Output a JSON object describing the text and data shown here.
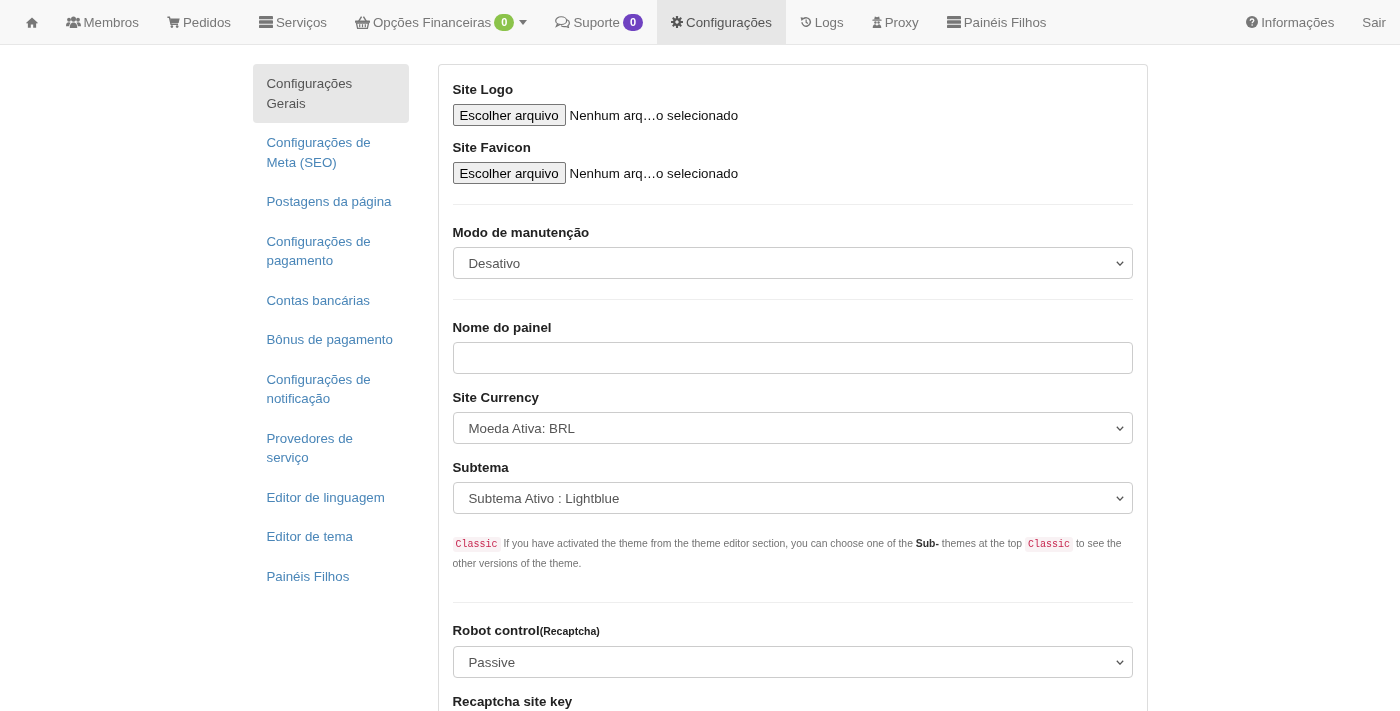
{
  "nav": {
    "home": {
      "selected": false
    },
    "items": [
      {
        "label": "Membros",
        "selected": false
      },
      {
        "label": "Pedidos",
        "selected": false
      },
      {
        "label": "Serviços",
        "selected": false
      },
      {
        "label": "Opções Financeiras",
        "selected": false,
        "badge": {
          "text": "0",
          "color": "#8bc34a"
        },
        "dropdown": true
      },
      {
        "label": "Suporte",
        "selected": false,
        "badge": {
          "text": "0",
          "color": "#6f42c1"
        }
      },
      {
        "label": "Configurações",
        "selected": true
      },
      {
        "label": "Logs",
        "selected": false
      },
      {
        "label": "Proxy",
        "selected": false
      },
      {
        "label": "Painéis Filhos",
        "selected": false
      }
    ],
    "right_items": [
      {
        "label": "Informações",
        "selected": false
      },
      {
        "label": "Sair",
        "selected": false
      }
    ]
  },
  "sidebar": {
    "items": [
      {
        "label": "Configurações Gerais",
        "selected": true
      },
      {
        "label": "Configurações de Meta (SEO)",
        "selected": false
      },
      {
        "label": "Postagens da página",
        "selected": false
      },
      {
        "label": "Configurações de pagamento",
        "selected": false
      },
      {
        "label": "Contas bancárias",
        "selected": false
      },
      {
        "label": "Bônus de pagamento",
        "selected": false
      },
      {
        "label": "Configurações de notificação",
        "selected": false
      },
      {
        "label": "Provedores de serviço",
        "selected": false
      },
      {
        "label": "Editor de linguagem",
        "selected": false
      },
      {
        "label": "Editor de tema",
        "selected": false
      },
      {
        "label": "Painéis Filhos",
        "selected": false
      }
    ]
  },
  "settings_panel": {
    "sections": [
      {
        "fields": [
          {
            "kind": "file",
            "label": "Site Logo",
            "button": "Escolher arquivo",
            "status": "Nenhum arq…o selecionado"
          },
          {
            "kind": "file",
            "label": "Site Favicon",
            "button": "Escolher arquivo",
            "status": "Nenhum arq…o selecionado"
          }
        ]
      },
      {
        "fields": [
          {
            "kind": "select",
            "label": "Modo de manutenção",
            "value": "Desativo"
          }
        ]
      },
      {
        "fields": [
          {
            "kind": "text",
            "label": "Nome do painel"
          },
          {
            "kind": "select",
            "label": "Site Currency",
            "value": "Moeda Ativa: BRL"
          },
          {
            "kind": "select",
            "label": "Subtema",
            "value": "Subtema Ativo : Lightblue"
          },
          {
            "kind": "help",
            "segments": [
              {
                "kind": "code",
                "text": "Classic"
              },
              {
                "kind": "text",
                "text": " If you have activated the theme from the theme editor section, you can choose one of the **Sub-** themes at the top "
              },
              {
                "kind": "code",
                "text": "Classic"
              },
              {
                "kind": "text",
                "text": " to see the other versions of the theme."
              }
            ]
          }
        ]
      },
      {
        "fields": [
          {
            "kind": "select",
            "label": "Robot control",
            "label_note": "(Recaptcha)",
            "value": "Passive"
          },
          {
            "kind": "label",
            "label": "Recaptcha site key"
          }
        ]
      }
    ]
  }
}
